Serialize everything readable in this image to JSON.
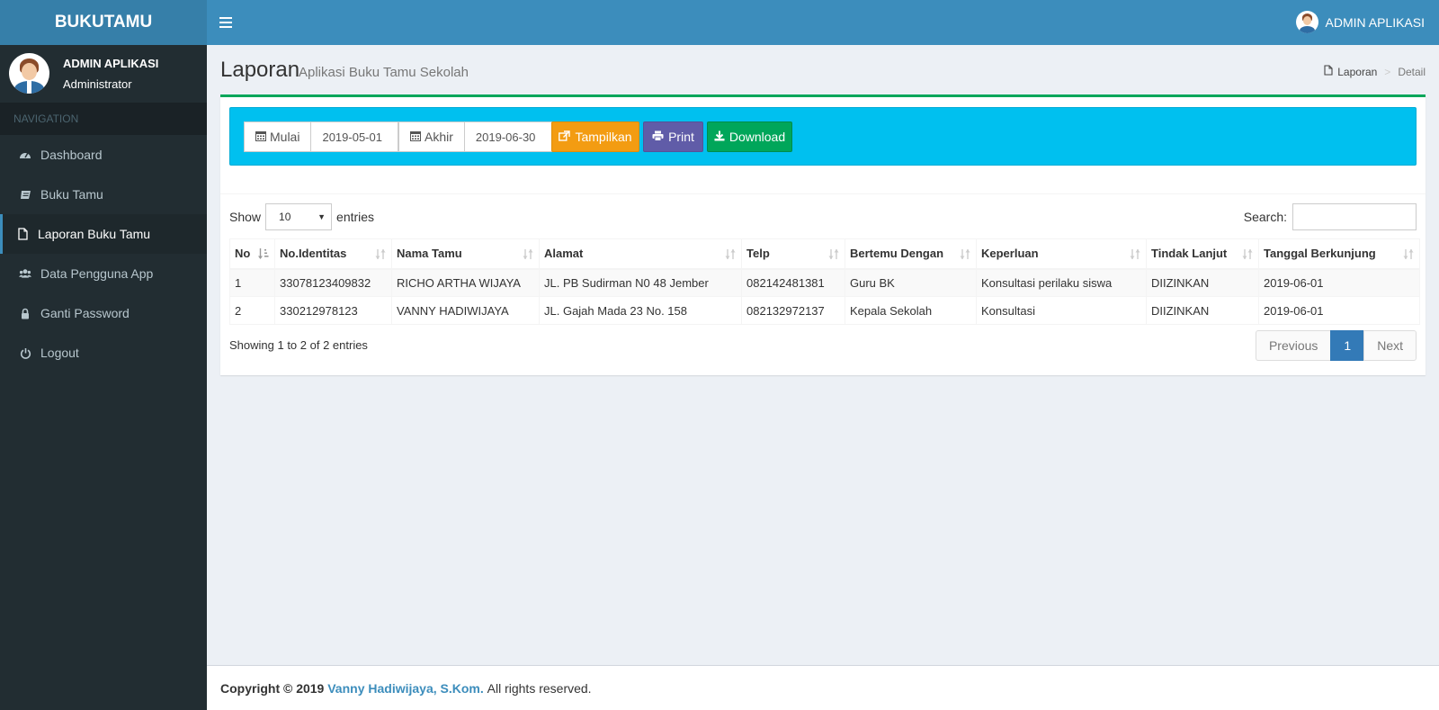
{
  "app": {
    "brand": "BUKUTAMU"
  },
  "topbar": {
    "user_name": "ADMIN APLIKASI"
  },
  "sidebar": {
    "user_name": "ADMIN APLIKASI",
    "user_role": "Administrator",
    "nav_header": "NAVIGATION",
    "items": [
      {
        "label": "Dashboard",
        "icon": "dashboard-icon",
        "active": false
      },
      {
        "label": "Buku Tamu",
        "icon": "book-icon",
        "active": false
      },
      {
        "label": "Laporan Buku Tamu",
        "icon": "file-icon",
        "active": true
      },
      {
        "label": "Data Pengguna App",
        "icon": "users-icon",
        "active": false
      },
      {
        "label": "Ganti Password",
        "icon": "lock-icon",
        "active": false
      },
      {
        "label": "Logout",
        "icon": "power-icon",
        "active": false
      }
    ]
  },
  "page": {
    "title": "Laporan",
    "subtitle": "Aplikasi Buku Tamu Sekolah",
    "breadcrumb": [
      "Laporan",
      "Detail"
    ]
  },
  "filter": {
    "start_label": "Mulai",
    "start_value": "2019-05-01",
    "end_label": "Akhir",
    "end_value": "2019-06-30",
    "show_button": "Tampilkan",
    "print_button": "Print",
    "download_button": "Download"
  },
  "table_controls": {
    "show_label": "Show",
    "entries_value": "10",
    "entries_label": "entries",
    "search_label": "Search:"
  },
  "table": {
    "columns": [
      "No",
      "No.Identitas",
      "Nama Tamu",
      "Alamat",
      "Telp",
      "Bertemu Dengan",
      "Keperluan",
      "Tindak Lanjut",
      "Tanggal Berkunjung"
    ],
    "rows": [
      [
        "1",
        "33078123409832",
        "RICHO ARTHA WIJAYA",
        "JL. PB Sudirman N0 48 Jember",
        "082142481381",
        "Guru BK",
        "Konsultasi perilaku siswa",
        "DIIZINKAN",
        "2019-06-01"
      ],
      [
        "2",
        "330212978123",
        "VANNY HADIWIJAYA",
        "JL. Gajah Mada 23 No. 158",
        "082132972137",
        "Kepala Sekolah",
        "Konsultasi",
        "DIIZINKAN",
        "2019-06-01"
      ]
    ]
  },
  "pagination": {
    "info": "Showing 1 to 2 of 2 entries",
    "previous": "Previous",
    "current": "1",
    "next": "Next"
  },
  "footer": {
    "copyright": "Copyright © 2019",
    "author": "Vanny Hadiwijaya, S.Kom.",
    "rights": "All rights reserved."
  },
  "colors": {
    "header": "#3c8dbc",
    "logo": "#367fa9",
    "sidebar": "#222d32",
    "filter_bg": "#00c0ef",
    "btn_show": "#f39c12",
    "btn_print": "#605ca8",
    "btn_download": "#00a65a"
  }
}
